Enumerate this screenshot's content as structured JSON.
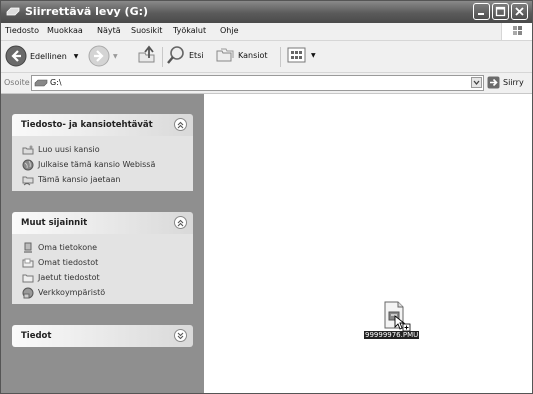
{
  "window": {
    "title": "Siirrettävä levy (G:)"
  },
  "menu": [
    "Tiedosto",
    "Muokkaa",
    "Näytä",
    "Suosikit",
    "Työkalut",
    "Ohje"
  ],
  "toolbar": {
    "back_label": "Edellinen",
    "search_label": "Etsi",
    "folders_label": "Kansiot"
  },
  "address": {
    "label": "Osoite",
    "value": "G:\\",
    "go_label": "Siirry"
  },
  "panels": {
    "tasks": {
      "title": "Tiedosto- ja kansiotehtävät",
      "items": [
        "Luo uusi kansio",
        "Julkaise tämä kansio Webissä",
        "Tämä kansio jaetaan"
      ]
    },
    "places": {
      "title": "Muut sijainnit",
      "items": [
        "Oma tietokone",
        "Omat tiedostot",
        "Jaetut tiedostot",
        "Verkkoympäristö"
      ]
    },
    "details": {
      "title": "Tiedot"
    }
  },
  "files": [
    {
      "name": "99999976.PMU"
    }
  ],
  "icons": {
    "title": "drive-icon",
    "back": "back-arrow-icon",
    "forward": "forward-arrow-icon",
    "up": "up-folder-icon",
    "search": "search-icon",
    "folders": "folders-icon",
    "views": "views-icon",
    "go": "go-arrow-icon"
  }
}
